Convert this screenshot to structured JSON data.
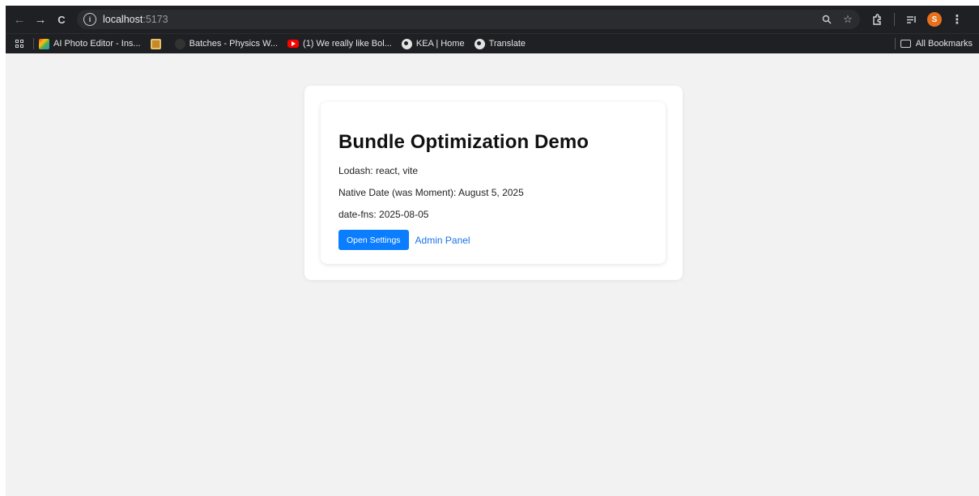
{
  "browser": {
    "url_host": "localhost",
    "url_port": ":5173",
    "nav": {
      "back": "←",
      "forward": "→",
      "reload": "C"
    },
    "omni_icons": {
      "zoom": "zoom-icon",
      "star": "star-icon"
    },
    "profile_initial": "S"
  },
  "bookmarks": {
    "items": [
      {
        "label": "AI Photo Editor - Ins...",
        "icon": "rainbow"
      },
      {
        "label": "",
        "icon": "photo"
      },
      {
        "label": "Batches - Physics W...",
        "icon": "dark"
      },
      {
        "label": "(1) We really like Bol...",
        "icon": "yt"
      },
      {
        "label": "KEA | Home",
        "icon": "globe"
      },
      {
        "label": "Translate",
        "icon": "globe"
      }
    ],
    "all_bookmarks": "All Bookmarks"
  },
  "page": {
    "title": "Bundle Optimization Demo",
    "lodash": "Lodash: react, vite",
    "native_date": "Native Date (was Moment): August 5, 2025",
    "date_fns": "date-fns: 2025-08-05",
    "open_settings": "Open Settings",
    "admin_panel": "Admin Panel"
  },
  "colors": {
    "primary": "#0b7dff",
    "link": "#1a73e8",
    "avatar": "#e8711c"
  }
}
